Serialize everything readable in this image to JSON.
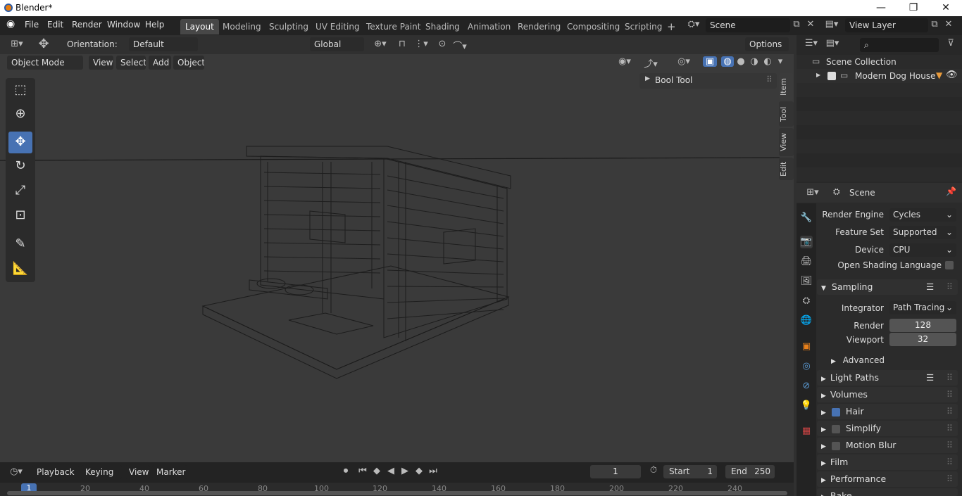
{
  "window": {
    "title": "Blender*",
    "minimize": "—",
    "restore": "❐",
    "close": "✕"
  },
  "menu": [
    "File",
    "Edit",
    "Render",
    "Window",
    "Help"
  ],
  "workspaces": [
    "Layout",
    "Modeling",
    "Sculpting",
    "UV Editing",
    "Texture Paint",
    "Shading",
    "Animation",
    "Rendering",
    "Compositing",
    "Scripting"
  ],
  "add_tab": "+",
  "scene_field": "Scene",
  "view_layer_field": "View Layer",
  "viewport_header": {
    "orientation_label": "Orientation:",
    "orientation_value": "Default",
    "transform": "Global",
    "options": "Options"
  },
  "viewport_header2": {
    "mode": "Object Mode",
    "menus": [
      "View",
      "Select",
      "Add",
      "Object"
    ]
  },
  "npanel": {
    "bool_tool": "Bool Tool",
    "tabs": [
      "Item",
      "Tool",
      "View",
      "Edit"
    ]
  },
  "outliner": {
    "collection": "Scene Collection",
    "items": [
      "Modern Dog House"
    ]
  },
  "properties": {
    "context": "Scene",
    "render_engine_label": "Render Engine",
    "render_engine": "Cycles",
    "feature_set_label": "Feature Set",
    "feature_set": "Supported",
    "device_label": "Device",
    "device": "CPU",
    "osl_label": "Open Shading Language",
    "sampling": "Sampling",
    "integrator_label": "Integrator",
    "integrator": "Path Tracing",
    "render_label": "Render",
    "render_value": "128",
    "viewport_label": "Viewport",
    "viewport_value": "32",
    "advanced": "Advanced",
    "sections": [
      "Light Paths",
      "Volumes",
      "Hair",
      "Simplify",
      "Motion Blur",
      "Film",
      "Performance",
      "Bake"
    ],
    "hair_checked": true
  },
  "timeline": {
    "menus": [
      "Playback",
      "Keying",
      "View",
      "Marker"
    ],
    "current_frame": "1",
    "start_label": "Start",
    "start": "1",
    "end_label": "End",
    "end": "250",
    "ticks": [
      "1",
      "20",
      "40",
      "60",
      "80",
      "100",
      "120",
      "140",
      "160",
      "180",
      "200",
      "220",
      "240"
    ]
  }
}
